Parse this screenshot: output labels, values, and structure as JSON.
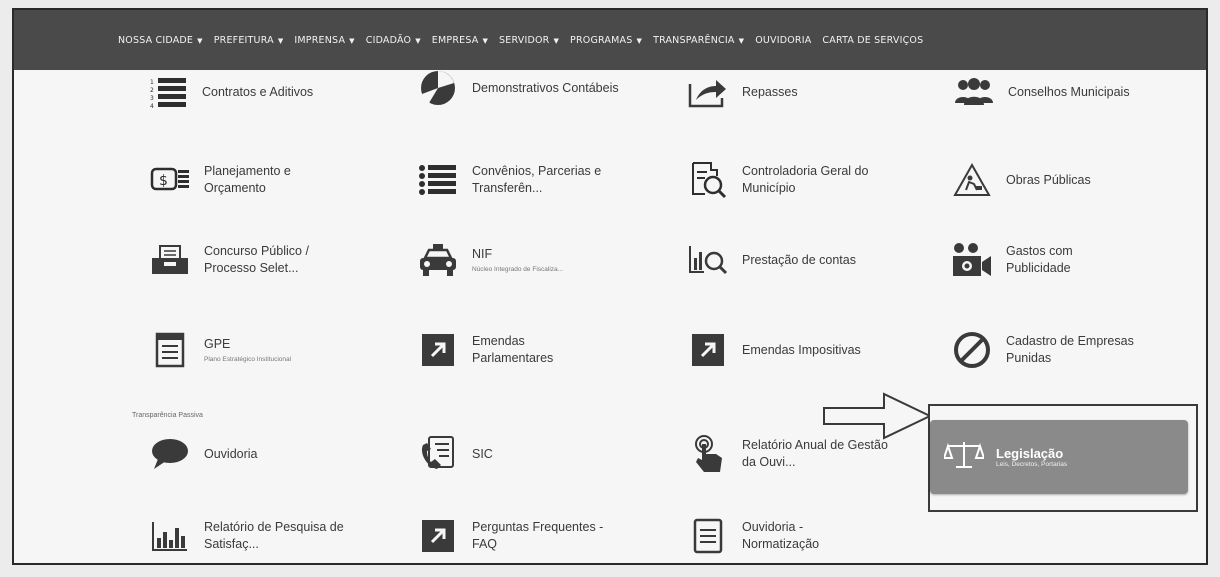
{
  "nav": {
    "items": [
      {
        "label": "NOSSA CIDADE",
        "caret": true
      },
      {
        "label": "PREFEITURA",
        "caret": true
      },
      {
        "label": "IMPRENSA",
        "caret": true
      },
      {
        "label": "CIDADÃO",
        "caret": true
      },
      {
        "label": "EMPRESA",
        "caret": true
      },
      {
        "label": "SERVIDOR",
        "caret": true
      },
      {
        "label": "PROGRAMAS",
        "caret": true
      },
      {
        "label": "TRANSPARÊNCIA",
        "caret": true
      },
      {
        "label": "OUVIDORIA",
        "caret": false
      },
      {
        "label": "CARTA DE SERVIÇOS",
        "caret": false
      }
    ]
  },
  "tiles": {
    "contratos": {
      "label": "Contratos e Aditivos",
      "icon": "list-numbered-icon"
    },
    "demonstrativos": {
      "label": "Demonstrativos Contábeis",
      "icon": "pie-chart-icon"
    },
    "repasses": {
      "label": "Repasses",
      "icon": "share-arrow-icon"
    },
    "conselhos": {
      "label": "Conselhos Municipais",
      "icon": "group-icon"
    },
    "planejamento": {
      "label": "Planejamento e Orçamento",
      "icon": "money-icon"
    },
    "convenios": {
      "label": "Convênios, Parcerias e Transferên...",
      "icon": "list-icon"
    },
    "controladoria": {
      "label": "Controladoria Geral do Município",
      "icon": "document-search-icon"
    },
    "obras": {
      "label": "Obras Públicas",
      "icon": "construction-sign-icon"
    },
    "concurso": {
      "label": "Concurso Público / Processo Selet...",
      "icon": "inbox-icon"
    },
    "nif": {
      "label": "NIF",
      "sublabel": "Núcleo Integrado de Fiscaliza...",
      "icon": "car-icon"
    },
    "prestacao": {
      "label": "Prestação de contas",
      "icon": "chart-search-icon"
    },
    "gastos": {
      "label": "Gastos com Publicidade",
      "icon": "video-camera-icon"
    },
    "gpe": {
      "label": "GPE",
      "sublabel": "Plano Estratégico Institucional",
      "icon": "document-icon"
    },
    "emendas_parl": {
      "label": "Emendas Parlamentares",
      "icon": "external-link-icon"
    },
    "emendas_imp": {
      "label": "Emendas Impositivas",
      "icon": "external-link-icon"
    },
    "cadastro": {
      "label": "Cadastro de Empresas Punidas",
      "icon": "ban-icon"
    },
    "ouvidoria": {
      "label": "Ouvidoria",
      "icon": "speech-bubble-icon"
    },
    "sic": {
      "label": "SIC",
      "icon": "phone-document-icon"
    },
    "relatorio_anual": {
      "label": "Relatório Anual de Gestão da Ouvi...",
      "icon": "touch-icon"
    },
    "relatorio_pesquisa": {
      "label": "Relatório de Pesquisa de Satisfaç...",
      "icon": "bar-chart-icon"
    },
    "perguntas": {
      "label": "Perguntas Frequentes - FAQ",
      "icon": "external-link-icon"
    },
    "ouvidoria_norm": {
      "label": "Ouvidoria - Normatização",
      "icon": "document-lines-icon"
    }
  },
  "section": {
    "label": "Transparência Passiva"
  },
  "legislacao": {
    "title": "Legislação",
    "subtitle": "Leis, Decretos, Portarias",
    "icon": "scales-icon"
  }
}
